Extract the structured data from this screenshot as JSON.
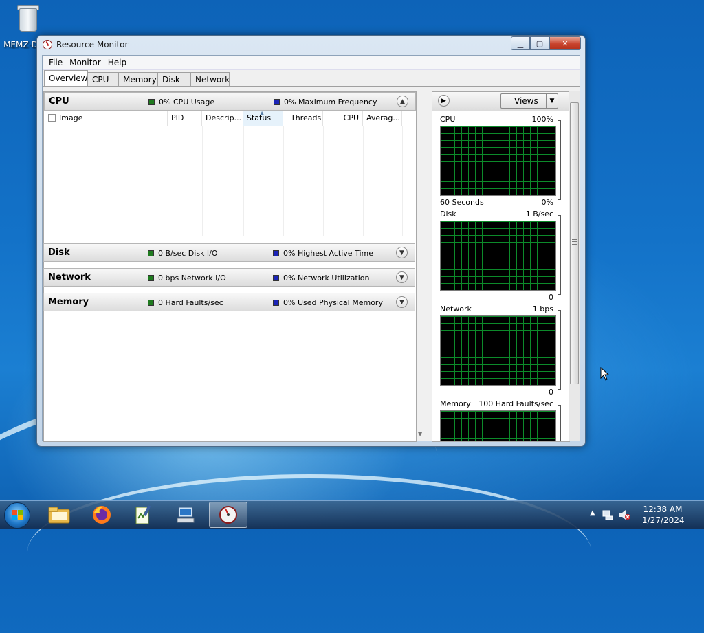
{
  "desktop": {
    "icon_label": "MEMZ-D"
  },
  "window": {
    "title": "Resource Monitor",
    "menu": [
      "File",
      "Monitor",
      "Help"
    ],
    "tabs": [
      "Overview",
      "CPU",
      "Memory",
      "Disk",
      "Network"
    ],
    "active_tab": "Overview"
  },
  "cpu_section": {
    "title": "CPU",
    "stat1": "0% CPU Usage",
    "stat2": "0% Maximum Frequency",
    "columns": [
      "Image",
      "PID",
      "Descrip...",
      "Status",
      "Threads",
      "CPU",
      "Averag..."
    ],
    "sorted_column": "Status"
  },
  "sections": [
    {
      "title": "Disk",
      "stat1": "0 B/sec Disk I/O",
      "stat2": "0% Highest Active Time"
    },
    {
      "title": "Network",
      "stat1": "0 bps Network I/O",
      "stat2": "0% Network Utilization"
    },
    {
      "title": "Memory",
      "stat1": "0 Hard Faults/sec",
      "stat2": "0% Used Physical Memory"
    }
  ],
  "graphs_panel": {
    "views_label": "Views",
    "graphs": [
      {
        "name": "CPU",
        "max": "100%",
        "footer_left": "60 Seconds",
        "footer_right": "0%"
      },
      {
        "name": "Disk",
        "max": "1 B/sec",
        "footer_left": "",
        "footer_right": "0"
      },
      {
        "name": "Network",
        "max": "1 bps",
        "footer_left": "",
        "footer_right": "0"
      },
      {
        "name": "Memory",
        "max": "100 Hard Faults/sec",
        "footer_left": "",
        "footer_right": ""
      }
    ]
  },
  "taskbar": {
    "apps": [
      "explorer-icon",
      "firefox-icon",
      "notepad-icon",
      "network-computer-icon",
      "resource-monitor-icon"
    ],
    "time": "12:38 AM",
    "date": "1/27/2024"
  },
  "colors": {
    "cpu_usage_green": "#1f7a1f",
    "max_freq_blue": "#1b24b8",
    "graph_grid": "#0c8a2a"
  }
}
